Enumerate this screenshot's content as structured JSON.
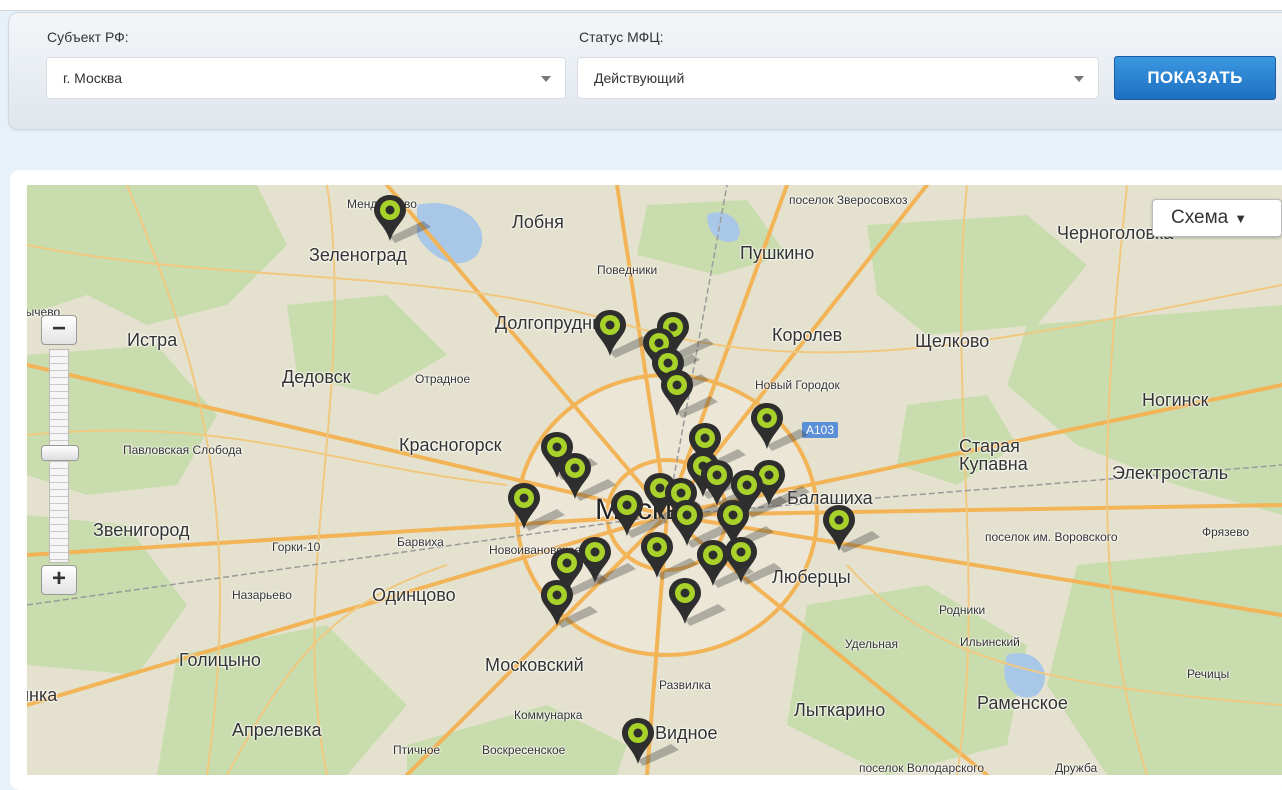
{
  "filter": {
    "region_label": "Субъект РФ:",
    "region_value": "г. Москва",
    "status_label": "Статус МФЦ:",
    "status_value": "Действующий",
    "show_button": "ПОКАЗАТЬ"
  },
  "map": {
    "type_control": "Схема",
    "zoom_in": "+",
    "zoom_out": "−",
    "road_badge": "A103",
    "places": {
      "lobnya": "Лобня",
      "zelenograd": "Зеленоград",
      "pushkino": "Пушкино",
      "chernogolovka": "Черноголовка",
      "povedniki": "Поведники",
      "dolgoprudny": "Долгопрудный",
      "korolev": "Королев",
      "schelkovo": "Щелково",
      "istra": "Истра",
      "dedovsk": "Дедовск",
      "otradnoe": "Отрадное",
      "noviy_gorodok": "Новый Городок",
      "noginsk": "Ногинск",
      "krasnogorsk": "Красногорск",
      "pavlovskaya_sloboda": "Павловская Слобода",
      "staraya_kupavna": "Старая Купавна",
      "elektrostal": "Электросталь",
      "moskva": "Москва",
      "balashikha": "Балашиха",
      "zvenigorod": "Звенигород",
      "gorki10": "Горки-10",
      "barvikha": "Барвиха",
      "novoivankovo": "Новоивановское",
      "pos_vorovskogo": "поселок им. Воровского",
      "fryazevo": "Фрязево",
      "lyubertsy": "Люберцы",
      "nazaryevo": "Назарьево",
      "odintsovo": "Одинцово",
      "rodniki": "Родники",
      "udelnaya": "Удельная",
      "ilinsky": "Ильинский",
      "golitsyno": "Голицыно",
      "moskovsky": "Московский",
      "rechitsy": "Речицы",
      "razvilka": "Развилка",
      "kubinka": "Кубинка",
      "kommunarka": "Коммунарка",
      "lytkarino": "Лыткарино",
      "ramenskoe": "Раменское",
      "aprelevka": "Апрелевка",
      "ptichnoe": "Птичное",
      "voskresenskoe": "Воскресенское",
      "vidnoe": "Видное",
      "pos_zverosovkhoz": "поселок Зверосовхоз",
      "pos_volodarskogo": "поселок Володарского",
      "druzhba": "Дружба",
      "mendeleevo": "Менделеево",
      "west_edge": "Сычево"
    },
    "marker_count": 29,
    "colors": {
      "marker_body": "#2e2e2e",
      "marker_ring": "#a8d22a",
      "button_blue": "#1e70c2"
    }
  }
}
